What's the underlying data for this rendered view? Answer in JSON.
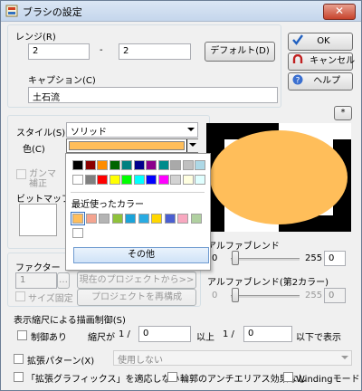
{
  "window": {
    "title": "ブラシの設定",
    "close_label": "✕"
  },
  "range": {
    "label": "レンジ(R)",
    "from_value": "2",
    "separator": "-",
    "to_value": "2",
    "default_button": "デフォルト(D)"
  },
  "caption": {
    "label": "キャプション(C)",
    "value": "土石流"
  },
  "buttons": {
    "ok": "OK",
    "cancel": "キャンセル",
    "help": "ヘルプ",
    "star": "*"
  },
  "style": {
    "label": "スタイル(S)",
    "value": "ソリッド"
  },
  "color": {
    "label": "色(C)",
    "value_color": "#ffbe5a"
  },
  "gamma": {
    "label_line1": "ガンマ",
    "label_line2": "補正"
  },
  "bitmap": {
    "label": "ビットマップ"
  },
  "factor": {
    "label": "ファクター",
    "value": "1"
  },
  "size_fixed": {
    "label": "サイズ固定"
  },
  "project_buttons": {
    "from_current": "現在のプロジェクトから>>",
    "reconfigure": "プロジェクトを再構成"
  },
  "color_popup": {
    "palette": [
      [
        "#000000",
        "#8b0000",
        "#ff8c00",
        "#006400",
        "#008080",
        "#00008b",
        "#8b008b",
        "#008b8b",
        "#a9a9a9",
        "#c0c0c0",
        "#add8e6"
      ],
      [
        "#ffffff",
        "#808080",
        "#ff0000",
        "#ffff00",
        "#00ff00",
        "#00ffff",
        "#0000ff",
        "#ff00ff",
        "#d3d3d3",
        "#ffffe0",
        "#e0ffff"
      ]
    ],
    "recent_title": "最近使ったカラー",
    "recent": [
      "#ffbe5a",
      "#f4a490",
      "#b4b4b4",
      "#8fc23b",
      "#1aa3d9",
      "#29abe2",
      "#ffd700",
      "#4a5fd1",
      "#f8a8c0",
      "#b0d0a0"
    ],
    "empty_slot": "#ffffff",
    "other_button": "その他"
  },
  "preview": {
    "fill_color": "#ffbe5a",
    "bg_colors": [
      "#000000",
      "#ffffff"
    ]
  },
  "alpha_blend": {
    "label": "アルファブレンド",
    "min": "0",
    "max": "255",
    "value": "0"
  },
  "alpha_blend2": {
    "label": "アルファブレンド(第2カラー)",
    "min": "0",
    "max": "255",
    "value": "0"
  },
  "scale_control": {
    "section_label": "表示縮尺による描画制御(S)",
    "limit_label": "制御あり",
    "scale_label": "縮尺が",
    "one_over_1": "1 /",
    "min_value": "0",
    "above": "以上",
    "one_over_2": "1 /",
    "max_value": "0",
    "below": "以下で表示"
  },
  "ext_pattern": {
    "label": "拡張パターン(X)",
    "value": "使用しない"
  },
  "bottom_checks": {
    "ext_graphics": "「拡張グラフィックス」を適応しない",
    "no_antialias": "輪郭のアンチエリアス効果なし",
    "winding": "Windingモード"
  }
}
